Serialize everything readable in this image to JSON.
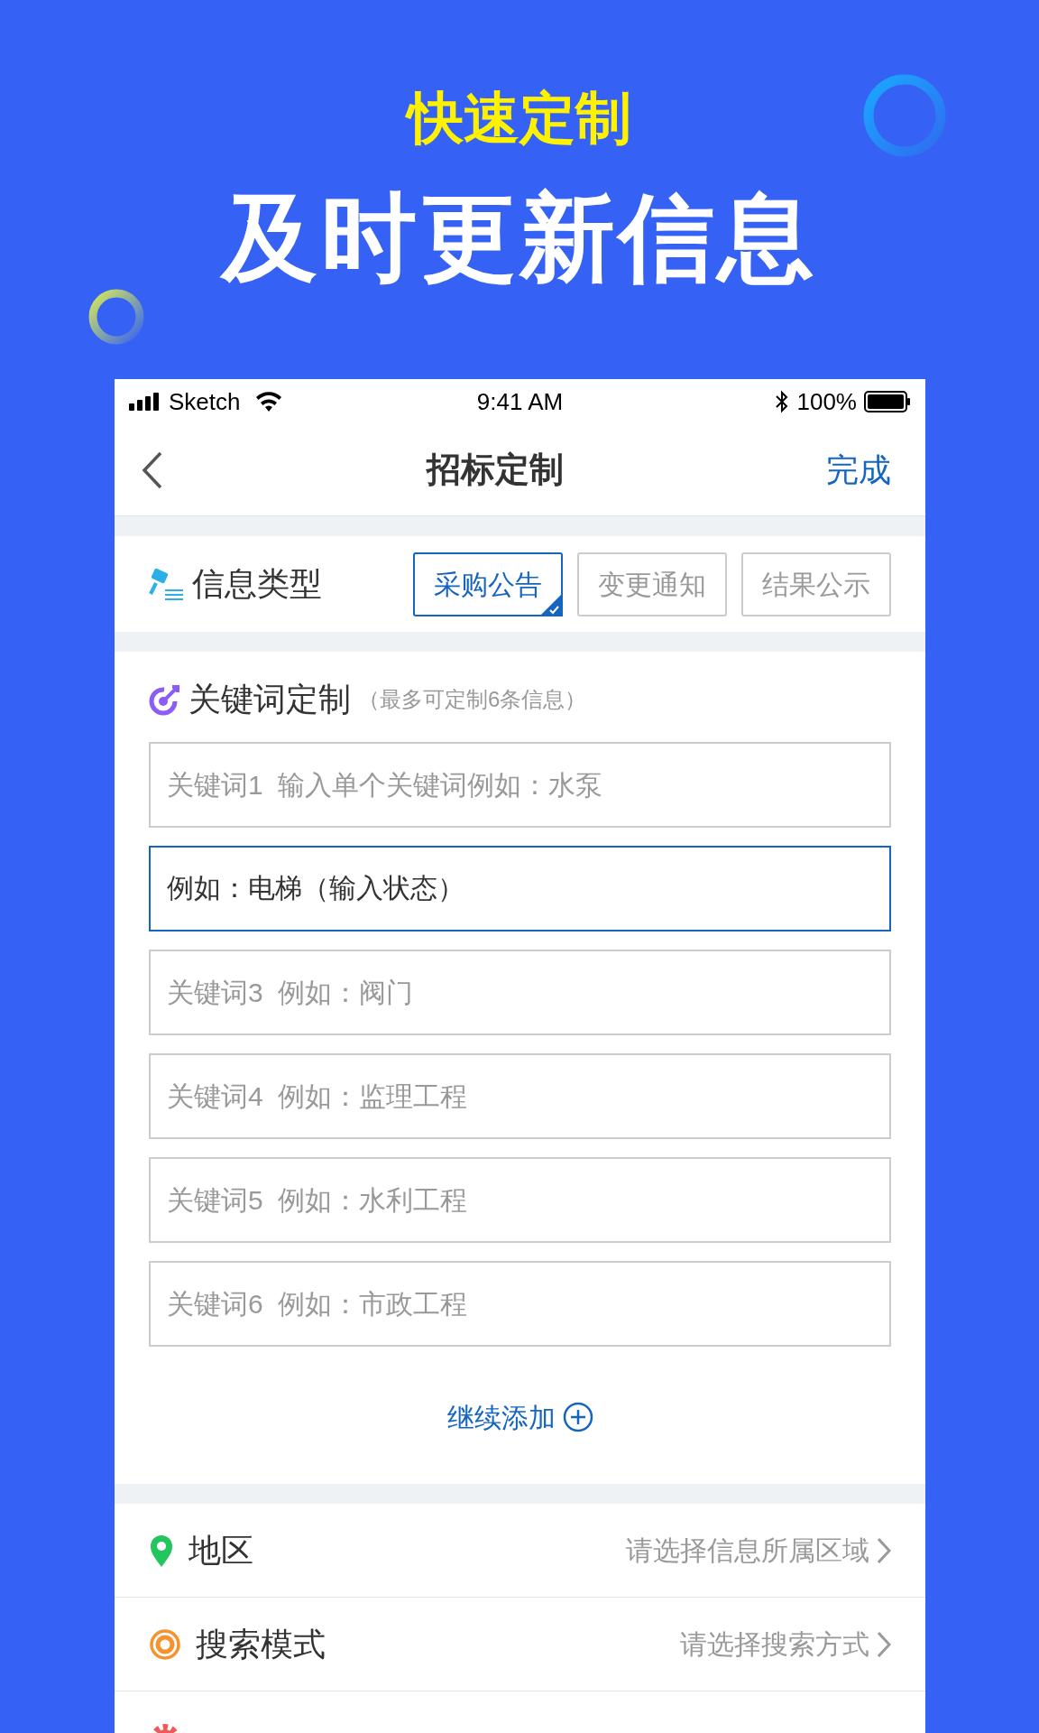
{
  "banner": {
    "subtitle": "快速定制",
    "title": "及时更新信息"
  },
  "status_bar": {
    "carrier": "Sketch",
    "time": "9:41 AM",
    "battery": "100%"
  },
  "nav": {
    "title": "招标定制",
    "action": "完成"
  },
  "info_type": {
    "label": "信息类型",
    "options": [
      {
        "label": "采购公告",
        "selected": true
      },
      {
        "label": "变更通知",
        "selected": false
      },
      {
        "label": "结果公示",
        "selected": false
      }
    ]
  },
  "keywords": {
    "title": "关键词定制",
    "note": "（最多可定制6条信息）",
    "fields": [
      {
        "placeholder": "关键词1  输入单个关键词例如：水泵",
        "focused": false
      },
      {
        "value": "例如：电梯（输入状态）",
        "focused": true
      },
      {
        "placeholder": "关键词3  例如：阀门",
        "focused": false
      },
      {
        "placeholder": "关键词4  例如：监理工程",
        "focused": false
      },
      {
        "placeholder": "关键词5  例如：水利工程",
        "focused": false
      },
      {
        "placeholder": "关键词6  例如：市政工程",
        "focused": false
      }
    ],
    "add_more": "继续添加"
  },
  "settings": [
    {
      "kind": "region",
      "label": "地区",
      "value": "请选择信息所属区域",
      "chosen": false
    },
    {
      "kind": "search",
      "label": "搜索模式",
      "value": "请选择搜索方式",
      "chosen": false
    },
    {
      "kind": "push"
    }
  ]
}
